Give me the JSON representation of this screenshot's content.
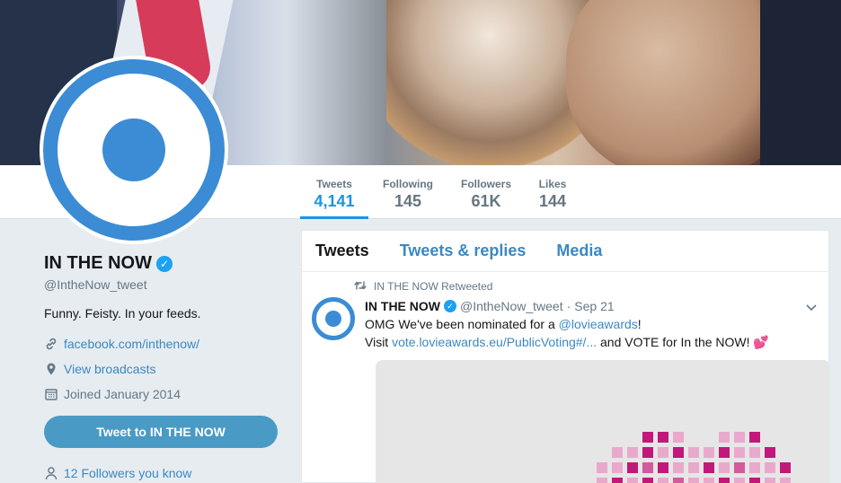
{
  "nav": {
    "items": [
      {
        "label": "Tweets",
        "value": "4,141",
        "active": true
      },
      {
        "label": "Following",
        "value": "145",
        "active": false
      },
      {
        "label": "Followers",
        "value": "61K",
        "active": false
      },
      {
        "label": "Likes",
        "value": "144",
        "active": false
      }
    ]
  },
  "profile": {
    "name": "IN THE NOW",
    "handle": "@IntheNow_tweet",
    "bio": "Funny. Feisty. In your feeds.",
    "website": "facebook.com/inthenow/",
    "broadcasts": "View broadcasts",
    "joined": "Joined January 2014",
    "tweet_to_button": "Tweet to IN THE NOW",
    "followers_you_know": "12 Followers you know"
  },
  "timeline": {
    "tabs": [
      {
        "label": "Tweets",
        "active": true
      },
      {
        "label": "Tweets & replies",
        "active": false
      },
      {
        "label": "Media",
        "active": false
      }
    ],
    "tweet": {
      "retweet_note": "IN THE NOW Retweeted",
      "author_name": "IN THE NOW",
      "author_handle": "@IntheNow_tweet",
      "separator": "·",
      "time": "Sep 21",
      "line1_prefix": "OMG We've been nominated for a ",
      "line1_mention": "@lovieawards",
      "line1_suffix": "!",
      "line2_prefix": "Visit ",
      "line2_link": "vote.lovieawards.eu/PublicVoting#/...",
      "line2_suffix": " and VOTE for In the NOW! ",
      "line2_emoji": "💕"
    }
  },
  "colors": {
    "accent": "#1b95e0",
    "brand_blue": "#3b8cd4",
    "link": "#3b88c3",
    "button": "#4a9ac6"
  }
}
